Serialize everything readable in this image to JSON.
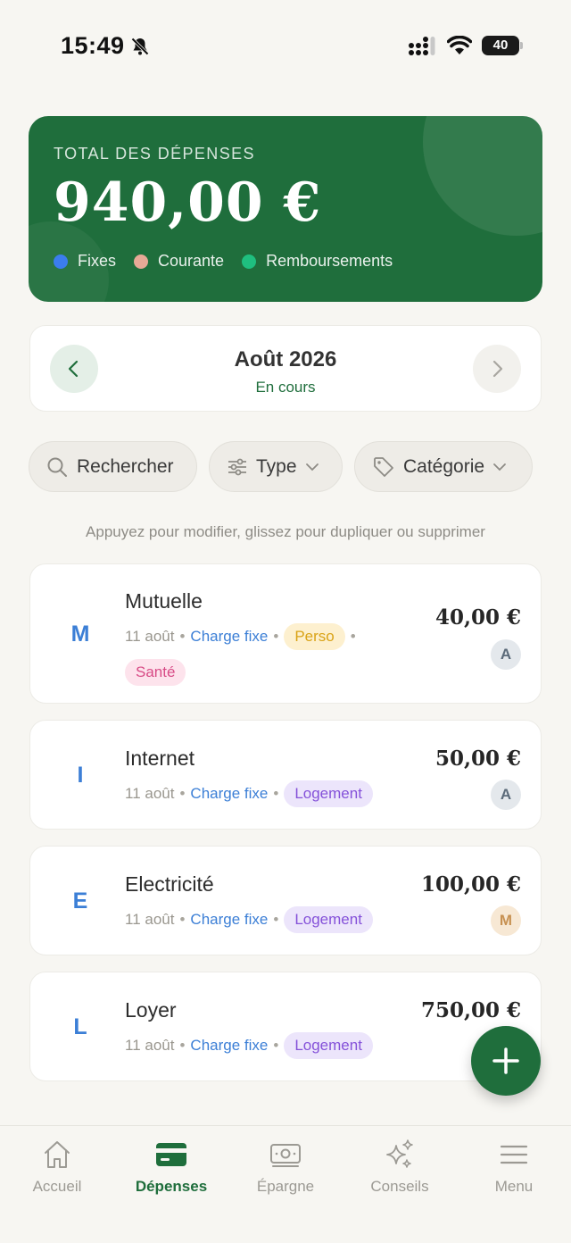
{
  "status_bar": {
    "time": "15:49",
    "battery": "40"
  },
  "summary": {
    "label": "TOTAL DES DÉPENSES",
    "total": "940,00 €",
    "legend": [
      {
        "label": "Fixes",
        "color": "#3b7ded"
      },
      {
        "label": "Courante",
        "color": "#e7a996"
      },
      {
        "label": "Remboursements",
        "color": "#1fbf7f"
      }
    ]
  },
  "period": {
    "title": "Août 2026",
    "subtitle": "En cours"
  },
  "filters": {
    "search": "Rechercher",
    "type": "Type",
    "category": "Catégorie"
  },
  "hint": "Appuyez pour modifier, glissez pour dupliquer ou supprimer",
  "expenses": [
    {
      "initial": "M",
      "name": "Mutuelle",
      "date": "11 août",
      "type": "Charge fixe",
      "tags": [
        "Perso",
        "Santé"
      ],
      "amount": "40,00 €",
      "owner": "A"
    },
    {
      "initial": "I",
      "name": "Internet",
      "date": "11 août",
      "type": "Charge fixe",
      "tags": [
        "Logement"
      ],
      "amount": "50,00 €",
      "owner": "A"
    },
    {
      "initial": "E",
      "name": "Electricité",
      "date": "11 août",
      "type": "Charge fixe",
      "tags": [
        "Logement"
      ],
      "amount": "100,00 €",
      "owner": "M"
    },
    {
      "initial": "L",
      "name": "Loyer",
      "date": "11 août",
      "type": "Charge fixe",
      "tags": [
        "Logement"
      ],
      "amount": "750,00 €"
    }
  ],
  "tabs": [
    {
      "label": "Accueil",
      "icon": "home-icon"
    },
    {
      "label": "Dépenses",
      "icon": "card-icon",
      "active": true
    },
    {
      "label": "Épargne",
      "icon": "banknote-icon"
    },
    {
      "label": "Conseils",
      "icon": "sparkles-icon"
    },
    {
      "label": "Menu",
      "icon": "hamburger-icon"
    }
  ]
}
